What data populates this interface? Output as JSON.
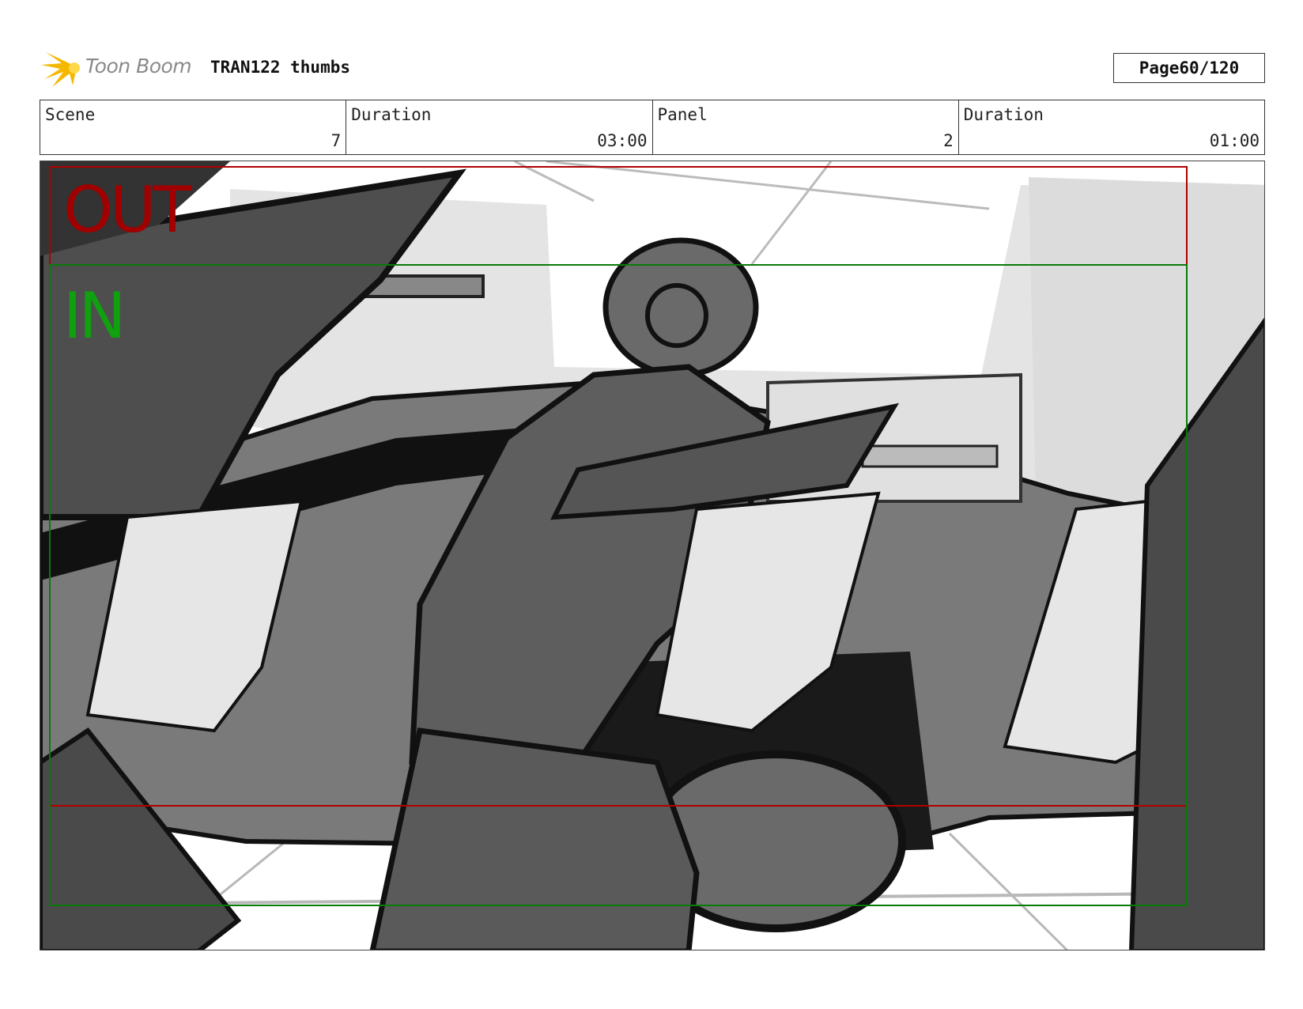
{
  "header": {
    "logo_text": "Toon Boom",
    "title": "TRAN122 thumbs",
    "page_label": "Page",
    "page_value": "60/120"
  },
  "info": {
    "scene_label": "Scene",
    "scene_value": "7",
    "scene_duration_label": "Duration",
    "scene_duration_value": "03:00",
    "panel_label": "Panel",
    "panel_value": "2",
    "panel_duration_label": "Duration",
    "panel_duration_value": "01:00"
  },
  "frame_labels": {
    "out": "OUT",
    "in": "IN"
  },
  "colors": {
    "out_frame": "#b00000",
    "in_frame": "#0a7a0a",
    "logo_yellow": "#f5b800"
  }
}
